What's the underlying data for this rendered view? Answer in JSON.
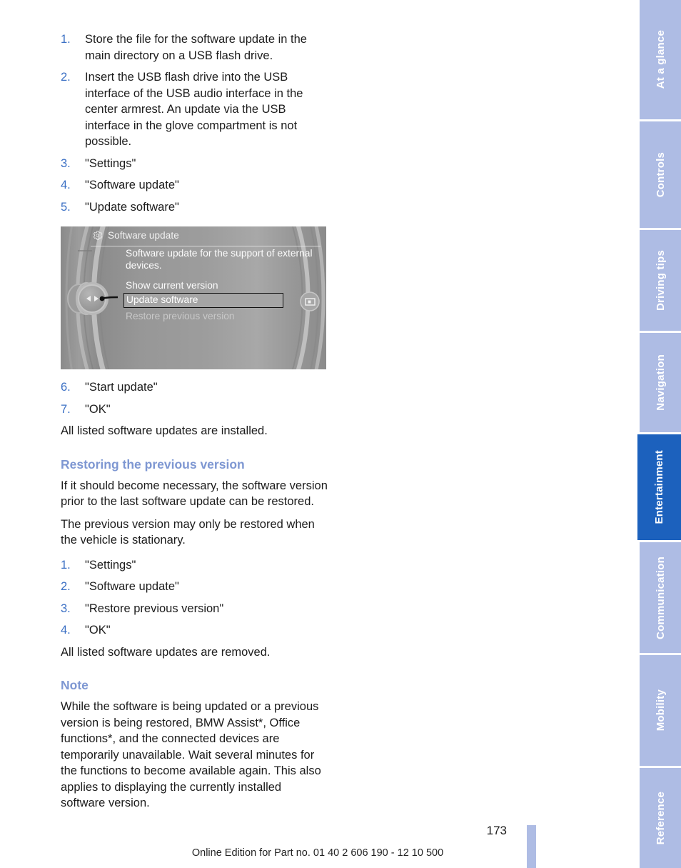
{
  "document": {
    "page_number": "173",
    "footer": "Online Edition for Part no. 01 40 2 606 190 - 12 10 500"
  },
  "steps_update": [
    {
      "num": "1.",
      "text": "Store the file for the software update in the main directory on a USB flash drive."
    },
    {
      "num": "2.",
      "text": "Insert the USB flash drive into the USB interface of the USB audio interface in the center armrest. An update via the USB interface in the glove compartment is not possible."
    },
    {
      "num": "3.",
      "text": "\"Settings\""
    },
    {
      "num": "4.",
      "text": "\"Software update\""
    },
    {
      "num": "5.",
      "text": "\"Update software\""
    }
  ],
  "figure": {
    "icon": "gear-icon",
    "title": "Software update",
    "description": "Software update for the support of external devices.",
    "items": [
      {
        "label": "Show current version",
        "state": "normal"
      },
      {
        "label": "Update software",
        "state": "selected"
      },
      {
        "label": "Restore previous version",
        "state": "dimmed"
      }
    ],
    "controller_icon": "idrive-controller-icon",
    "display_button_icon": "display-button-icon"
  },
  "steps_update_cont": [
    {
      "num": "6.",
      "text": "\"Start update\""
    },
    {
      "num": "7.",
      "text": "\"OK\""
    }
  ],
  "result_installed": "All listed software updates are installed.",
  "restore": {
    "heading": "Restoring the previous version",
    "para1": "If it should become necessary, the software version prior to the last software update can be restored.",
    "para2": "The previous version may only be restored when the vehicle is stationary.",
    "steps": [
      {
        "num": "1.",
        "text": "\"Settings\""
      },
      {
        "num": "2.",
        "text": "\"Software update\""
      },
      {
        "num": "3.",
        "text": "\"Restore previous version\""
      },
      {
        "num": "4.",
        "text": "\"OK\""
      }
    ],
    "result": "All listed software updates are removed."
  },
  "note": {
    "heading": "Note",
    "text": "While the software is being updated or a previous version is being restored, BMW Assist*, Office functions*, and the connected devices are temporarily unavailable. Wait several minutes for the functions to become available again. This also applies to displaying the currently installed software version."
  },
  "tabs": [
    {
      "label": "At a glance",
      "active": false
    },
    {
      "label": "Controls",
      "active": false
    },
    {
      "label": "Driving tips",
      "active": false
    },
    {
      "label": "Navigation",
      "active": false
    },
    {
      "label": "Entertainment",
      "active": true
    },
    {
      "label": "Communication",
      "active": false
    },
    {
      "label": "Mobility",
      "active": false
    },
    {
      "label": "Reference",
      "active": false
    }
  ],
  "colors": {
    "accent_blue": "#1c61bd",
    "tab_blue": "#aebce4",
    "heading_blue": "#7e97d2",
    "list_number_blue": "#3a6fc4"
  }
}
